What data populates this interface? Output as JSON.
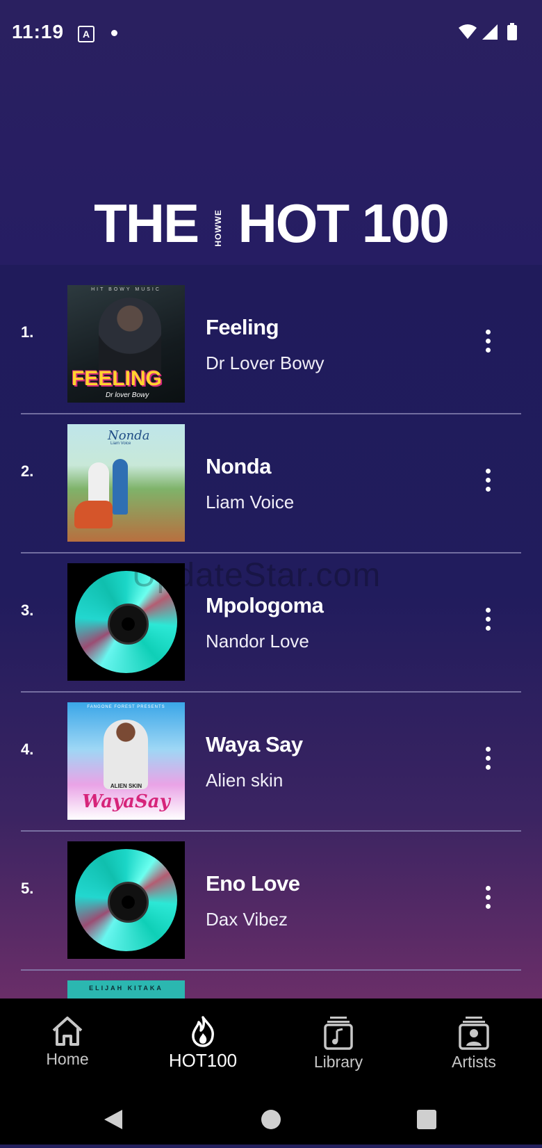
{
  "status_bar": {
    "time": "11:19",
    "notif_letter": "A"
  },
  "banner": {
    "title_left": "THE",
    "brand": "HOWWE",
    "title_right": "HOT 100"
  },
  "watermark": "UpdateStar.com",
  "tracks": [
    {
      "rank": "1.",
      "title": "Feeling",
      "artist": "Dr Lover Bowy",
      "cover_text": "FEELING",
      "cover_sub": "Dr lover Bowy",
      "cover_top": "HIT BOWY MUSIC"
    },
    {
      "rank": "2.",
      "title": "Nonda",
      "artist": "Liam Voice",
      "cover_text": "Nonda",
      "cover_sub": "Liam Voice"
    },
    {
      "rank": "3.",
      "title": "Mpologoma",
      "artist": "Nandor Love"
    },
    {
      "rank": "4.",
      "title": "Waya Say",
      "artist": "Alien skin",
      "cover_top": "FANGONE FOREST PRESENTS",
      "cover_text": "WayaSay",
      "cover_name": "ALIEN SKIN"
    },
    {
      "rank": "5.",
      "title": "Eno Love",
      "artist": "Dax Vibez"
    },
    {
      "cover_top": "ELIJAH KITAKA"
    }
  ],
  "nav": {
    "items": [
      {
        "label": "Home",
        "icon": "home-icon"
      },
      {
        "label": "HOT100",
        "icon": "flame-icon",
        "active": true
      },
      {
        "label": "Library",
        "icon": "library-icon"
      },
      {
        "label": "Artists",
        "icon": "artists-icon"
      }
    ]
  },
  "colors": {
    "background": "#241f5d",
    "nav_background": "#000000",
    "accent_cd": "#1bd6c7"
  }
}
